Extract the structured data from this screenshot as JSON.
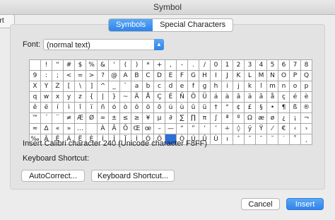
{
  "window": {
    "title": "Symbol"
  },
  "left_tab": {
    "label": "art"
  },
  "tabs": [
    {
      "label": "Symbols",
      "active": true
    },
    {
      "label": "Special Characters",
      "active": false
    }
  ],
  "font": {
    "label": "Font:",
    "value": "(normal text)"
  },
  "grid": {
    "rows": [
      [
        " ",
        "!",
        "\"",
        "#",
        "$",
        "%",
        "&",
        "'",
        "(",
        ")",
        "*",
        "+",
        ",",
        "-",
        ".",
        "/",
        "0",
        "1",
        "2",
        "3",
        "4",
        "5",
        "6",
        "7",
        "8"
      ],
      [
        "9",
        ":",
        ";",
        "<",
        "=",
        ">",
        "?",
        "@",
        "A",
        "B",
        "C",
        "D",
        "E",
        "F",
        "G",
        "H",
        "I",
        "J",
        "K",
        "L",
        "M",
        "N",
        "O",
        "P",
        "Q"
      ],
      [
        "X",
        "Y",
        "Z",
        "[",
        "\\",
        "]",
        "^",
        "_",
        "`",
        "a",
        "b",
        "c",
        "d",
        "e",
        "f",
        "g",
        "h",
        "i",
        "j",
        "k",
        "l",
        "m",
        "n",
        "o",
        "p"
      ],
      [
        "q",
        "w",
        "x",
        "y",
        "z",
        "{",
        "|",
        "}",
        "~",
        "Ä",
        "Å",
        "Ç",
        "É",
        "Ñ",
        "Ö",
        "Ü",
        "á",
        "à",
        "â",
        "ä",
        "ã",
        "å",
        "ç",
        "é",
        "è"
      ],
      [
        "ê",
        "ë",
        "í",
        "ì",
        "î",
        "ï",
        "ñ",
        "ó",
        "ò",
        "ô",
        "ö",
        "õ",
        "ú",
        "ù",
        "û",
        "ü",
        "†",
        "°",
        "¢",
        "£",
        "§",
        "•",
        "¶",
        "ß",
        "®"
      ],
      [
        "™",
        "´",
        "¨",
        "≠",
        "Æ",
        "Ø",
        "∞",
        "±",
        "≤",
        "≥",
        "¥",
        "µ",
        "∂",
        "∑",
        "∏",
        "π",
        "∫",
        "ª",
        "º",
        "Ω",
        "æ",
        "ø",
        "¿",
        "¡",
        "¬"
      ],
      [
        "≈",
        "∆",
        "«",
        "»",
        "…",
        " ",
        "À",
        "Ã",
        "Õ",
        "Œ",
        "œ",
        "–",
        "—",
        "“",
        "”",
        "‘",
        "’",
        "÷",
        "◊",
        "ÿ",
        "Ÿ",
        "⁄",
        "€",
        "‹",
        "›"
      ],
      [
        "‰",
        "Â",
        "Ê",
        "Á",
        "Ë",
        "È",
        "Í",
        "Î",
        "Ï",
        "Ì",
        "Ó",
        "Ô",
        "",
        "Ò",
        "Ú",
        "Û",
        "Ù",
        "ı",
        "ˆ",
        "˜",
        "¯",
        "˘",
        "˙",
        "˚",
        "¸"
      ]
    ],
    "selected_cell": {
      "row": 7,
      "col": 12
    }
  },
  "insert_info": "Insert Calibri character 240  (Unicode character F8FF)",
  "keyboard_shortcut_label": "Keyboard Shortcut:",
  "buttons": {
    "autocorrect": "AutoCorrect...",
    "keyboard_shortcut": "Keyboard Shortcut...",
    "cancel": "Cancel",
    "insert": "Insert"
  },
  "colors": {
    "accent": "#2f84ea",
    "selection": "#2d6fd8"
  }
}
